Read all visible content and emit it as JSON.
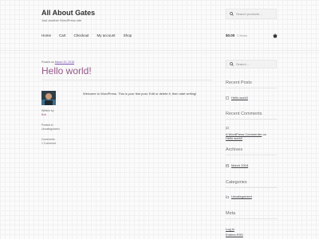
{
  "site": {
    "title": "All About Gates",
    "description": "Just another WordPress site"
  },
  "header_search": {
    "placeholder": "Search products…"
  },
  "nav": [
    "Home",
    "Cart",
    "Checkout",
    "My account",
    "Shop"
  ],
  "cart": {
    "total": "$0.00",
    "count": "0 items"
  },
  "post": {
    "posted_prefix": "Posted on",
    "date": "March 20, 2018",
    "title": "Hello world!",
    "written_by_label": "Written by",
    "author": "Bob",
    "posted_in_label": "Posted in",
    "category": "Uncategorized",
    "comments_label": "Comments",
    "comments_count": "1 Comment",
    "body": "Welcome to WordPress. This is your first post. Edit or delete it, then start writing!"
  },
  "sidebar": {
    "search_placeholder": "Search …",
    "recent_posts": {
      "title": "Recent Posts",
      "items": [
        "Hello world!"
      ]
    },
    "recent_comments": {
      "title": "Recent Comments",
      "commenter": "A WordPress Commenter",
      "on": "on",
      "post": "Hello world!"
    },
    "archives": {
      "title": "Archives",
      "items": [
        "March 2018"
      ]
    },
    "categories": {
      "title": "Categories",
      "items": [
        "Uncategorized"
      ]
    },
    "meta": {
      "title": "Meta",
      "items": [
        "Log in",
        "Entries RSS"
      ]
    }
  },
  "colors": {
    "accent": "#96588a",
    "link": "#7f54b3",
    "text": "#43454b"
  }
}
